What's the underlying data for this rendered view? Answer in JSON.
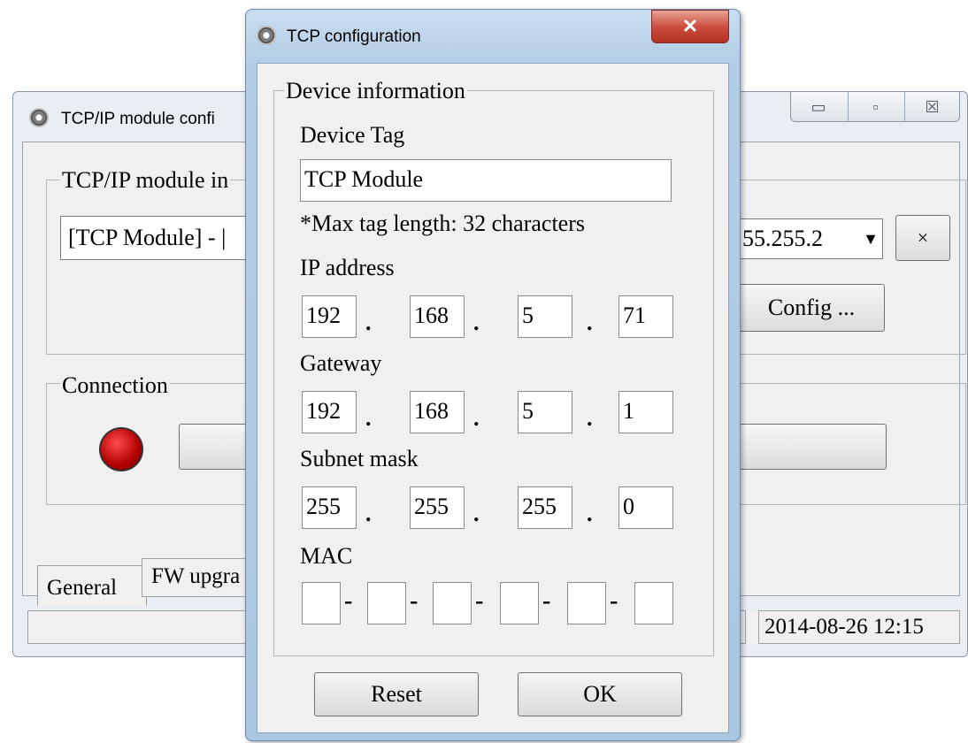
{
  "main_window": {
    "title": "TCP/IP module confi",
    "caption_buttons": {
      "minimize": "▭",
      "maximize": "▫",
      "close": "☒"
    },
    "module_group": {
      "legend": "TCP/IP module in",
      "combo_left": "[TCP Module] - |",
      "combo_right": "55.255.2",
      "remove_label": "×",
      "config_label": "Config ..."
    },
    "connection_group": {
      "legend": "Connection",
      "status_color": "#c40000"
    },
    "tabs": [
      "General",
      "FW upgra"
    ],
    "status_date": "2014-08-26 12:15"
  },
  "dialog": {
    "title": "TCP configuration",
    "close_label": "✕",
    "group_legend": "Device information",
    "device_tag": {
      "label": "Device Tag",
      "value": "TCP Module",
      "hint": "*Max tag length: 32 characters"
    },
    "ip": {
      "label": "IP address",
      "octets": [
        "192",
        "168",
        "5",
        "71"
      ]
    },
    "gateway": {
      "label": "Gateway",
      "octets": [
        "192",
        "168",
        "5",
        "1"
      ]
    },
    "subnet": {
      "label": "Subnet mask",
      "octets": [
        "255",
        "255",
        "255",
        "0"
      ]
    },
    "mac": {
      "label": "MAC",
      "parts": [
        "",
        "",
        "",
        "",
        "",
        ""
      ],
      "separator": "-"
    },
    "reset_label": "Reset",
    "ok_label": "OK",
    "octet_separator": "."
  }
}
